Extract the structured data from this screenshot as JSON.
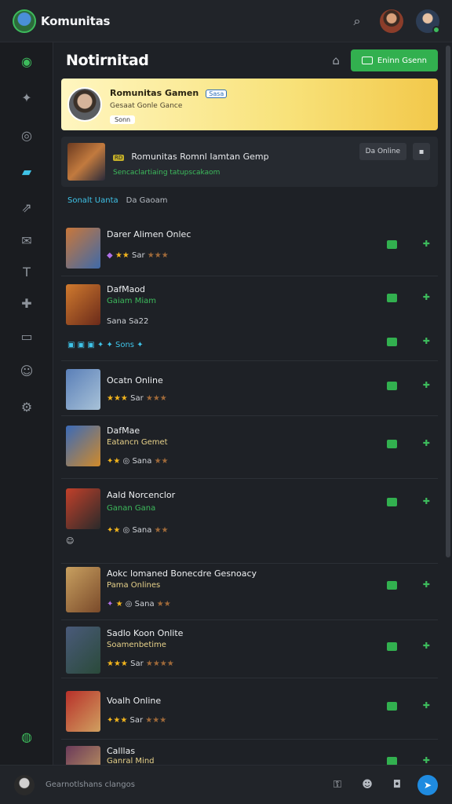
{
  "app": {
    "title": "Komunitas"
  },
  "header": {
    "title": "Notirnitad",
    "cta_label": "Eninn Gsenn"
  },
  "featured": {
    "name": "Romunitas Gamen",
    "chip": "Sasa",
    "sub": "Gesaat Gonle Gance",
    "pill": "Sonn"
  },
  "strip": {
    "tag": "RD",
    "name": "Romunitas Romnl Iamtan Gemp",
    "sub": "Sencaclartiaing tatupscakaom",
    "btn": "Da Online"
  },
  "status": {
    "a": "Sonalt Uanta",
    "b": "Da Gaoam"
  },
  "games": [
    {
      "name": "Darer Alimen Onlec",
      "sub": "",
      "rating": "Sar"
    },
    {
      "name": "DafMaod",
      "sub": "Gaiam Miam",
      "rating": "Sana  Sa22"
    },
    {
      "name": "Ocatn Online",
      "sub": "",
      "rating": "Sar"
    },
    {
      "name": "DafMae",
      "sub": "Eatancn Gemet",
      "rating": "Sana"
    },
    {
      "name": "Aald Norcenclor",
      "sub": "Ganan Gana",
      "rating": "Sana"
    },
    {
      "name": "Aokc lomaned Bonecdre Gesnoacy",
      "sub": "Pama Onlines",
      "rating": "Sana"
    },
    {
      "name": "Sadlo Koon Onlite",
      "sub": "Soamenbetime",
      "rating": "Sar"
    },
    {
      "name": "Voalh Online",
      "sub": "",
      "rating": "Sar"
    },
    {
      "name": "Calllas",
      "sub": "Ganral Mind",
      "rating": ""
    }
  ],
  "extra_row": {
    "label": "Sons"
  },
  "bottom": {
    "placeholder": "Gearnotlshans clangos"
  },
  "icons": [
    "search-icon",
    "home-icon",
    "notification-icon",
    "settings-icon",
    "chat-icon",
    "key-icon",
    "camera-icon",
    "send-icon"
  ],
  "colors": {
    "accent": "#32b04f",
    "featured": "#f8e27a",
    "link": "#3fc3e8"
  }
}
